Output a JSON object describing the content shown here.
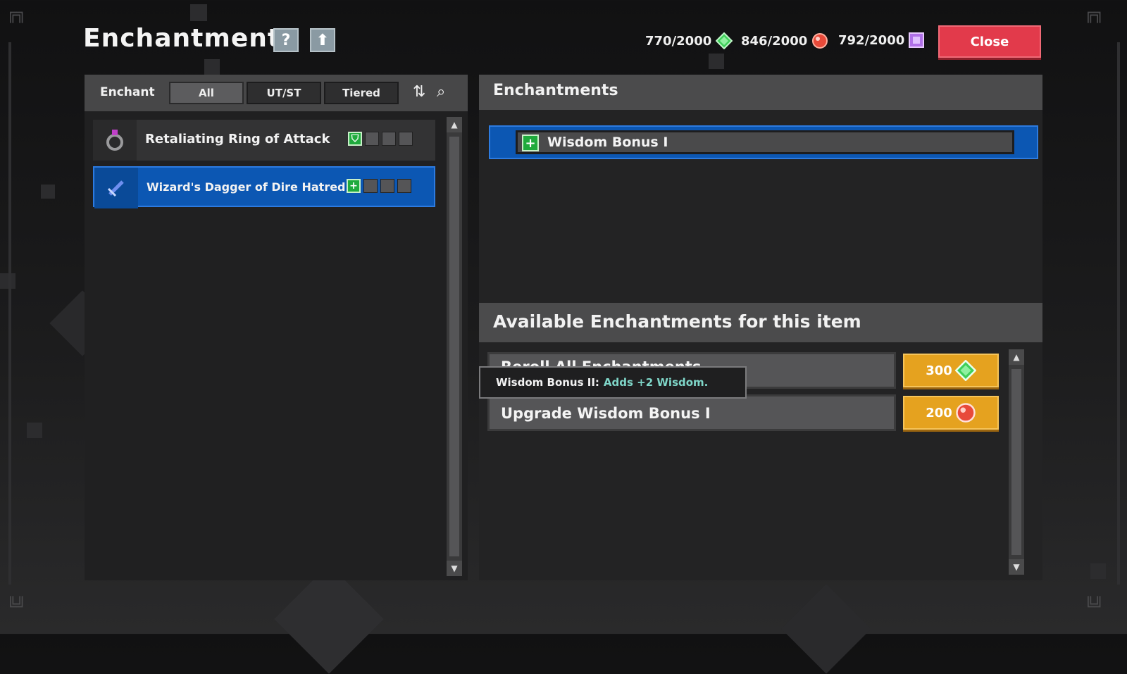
{
  "header": {
    "title": "Enchantments",
    "help_icon": "?",
    "upgrade_icon": "⬆",
    "close_label": "Close"
  },
  "currencies": [
    {
      "value": "770/2000",
      "icon": "green-gem-icon",
      "color": "#3fcf5a"
    },
    {
      "value": "846/2000",
      "icon": "red-gem-icon",
      "color": "#e84a3a"
    },
    {
      "value": "792/2000",
      "icon": "purple-gem-icon",
      "color": "#b070e8"
    }
  ],
  "left_panel": {
    "filter_label": "Enchant",
    "tabs": [
      {
        "label": "All",
        "active": true
      },
      {
        "label": "UT/ST",
        "active": false
      },
      {
        "label": "Tiered",
        "active": false
      }
    ],
    "items": [
      {
        "name": "Retaliating Ring of Attack",
        "icon": "ring-icon",
        "selected": false,
        "slot_icon": "shield-slot-icon"
      },
      {
        "name": "Wizard's Dagger of Dire Hatred",
        "icon": "dagger-icon",
        "selected": true,
        "slot_icon": "plus-slot-icon"
      }
    ]
  },
  "right_panel": {
    "enchantments_title": "Enchantments",
    "applied": [
      {
        "label": "Wisdom Bonus I"
      }
    ],
    "available_title": "Available Enchantments for this item",
    "available": [
      {
        "label": "Reroll All Enchantments",
        "cost": "300",
        "cost_icon": "green-gem-icon"
      },
      {
        "label": "Upgrade Wisdom Bonus I",
        "cost": "200",
        "cost_icon": "red-gem-icon"
      }
    ]
  },
  "tooltip": {
    "name": "Wisdom Bonus II:",
    "desc": "Adds +2 Wisdom."
  },
  "colors": {
    "selected_blue": "#0c57b3",
    "close_red": "#e23a4b",
    "cost_orange": "#e5a21f"
  }
}
